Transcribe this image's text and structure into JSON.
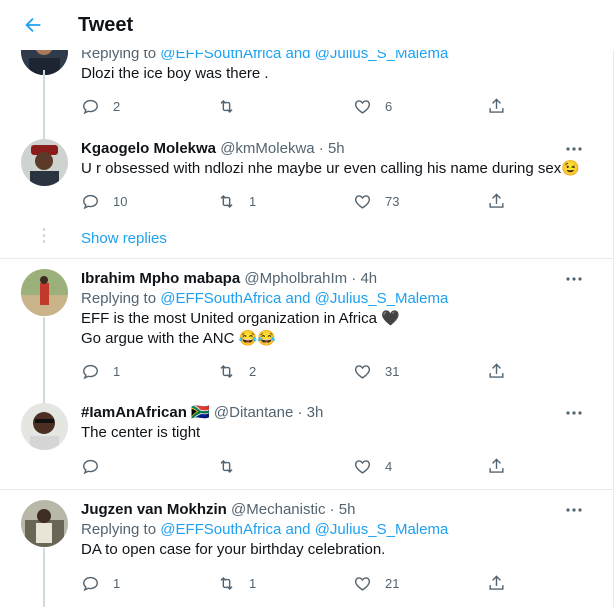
{
  "header": {
    "title": "Tweet"
  },
  "tweets": [
    {
      "replying_prefix": "Replying to",
      "replying_to": "@EFFSouthAfrica and @Julius_S_Malema",
      "text": "Dlozi the ice boy was there .",
      "replies": "2",
      "retweets": "",
      "likes": "6"
    },
    {
      "name": "Kgaogelo Molekwa",
      "handle": "@kmMolekwa · 5h",
      "text": "U r obsessed with ndlozi nhe maybe ur even calling his name during sex😉",
      "replies": "10",
      "retweets": "1",
      "likes": "73"
    },
    {
      "name": "Ibrahim Mpho mabapa",
      "handle": "@MpholbrahIm · 4h",
      "replying_prefix": "Replying to",
      "replying_to": "@EFFSouthAfrica and @Julius_S_Malema",
      "text_line1": "EFF is the most United organization in Africa 🖤",
      "text_line2": "Go argue with the ANC 😂😂",
      "replies": "1",
      "retweets": "2",
      "likes": "31"
    },
    {
      "name": "#IamAnAfrican 🇿🇦",
      "handle": "@Ditantane · 3h",
      "text": "The center is tight",
      "replies": "",
      "retweets": "",
      "likes": "4"
    },
    {
      "name": "Jugzen van Mokhzin",
      "handle": "@Mechanistic · 5h",
      "replying_prefix": "Replying to",
      "replying_to": "@EFFSouthAfrica and @Julius_S_Malema",
      "text": "DA to open case for your birthday celebration.",
      "replies": "1",
      "retweets": "1",
      "likes": "21"
    }
  ],
  "show_replies": "Show replies",
  "colors": {
    "accent": "#1da1f2",
    "secondary_text": "#536471",
    "divider": "#e6ecf0"
  }
}
